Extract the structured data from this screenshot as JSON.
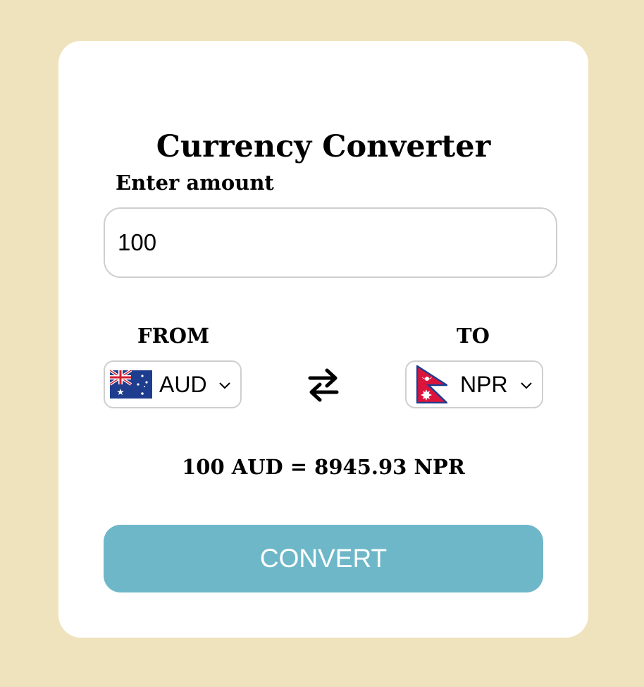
{
  "app": {
    "title": "Currency Converter"
  },
  "amount": {
    "label": "Enter amount",
    "value": "100"
  },
  "from": {
    "label": "FROM",
    "currency": "AUD",
    "flag_icon": "australia-flag-icon"
  },
  "to": {
    "label": "TO",
    "currency": "NPR",
    "flag_icon": "nepal-flag-icon"
  },
  "swap": {
    "icon": "swap-arrows-icon"
  },
  "result": {
    "text": "100 AUD = 8945.93 NPR"
  },
  "convert": {
    "label": "CONVERT"
  },
  "colors": {
    "background": "#efe3bd",
    "card": "#ffffff",
    "button": "#6eb7c8",
    "border": "#cfcfcf"
  }
}
